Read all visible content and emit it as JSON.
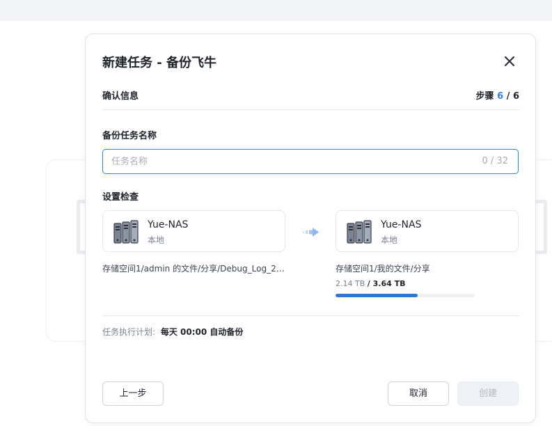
{
  "dialog": {
    "title": "新建任务 - 备份飞牛",
    "section_label": "确认信息",
    "step": {
      "prefix": "步骤",
      "current": "6",
      "separator": "/",
      "total": "6"
    }
  },
  "task_name": {
    "label": "备份任务名称",
    "placeholder": "任务名称",
    "value": "",
    "char_count": "0 / 32"
  },
  "settings": {
    "label": "设置检查",
    "source": {
      "name": "Yue-NAS",
      "location": "本地",
      "path": "存储空间1/admin 的文件/分享/Debug_Log_202..."
    },
    "target": {
      "name": "Yue-NAS",
      "location": "本地",
      "path": "存储空间1/我的文件/分享",
      "used": "2.14 TB",
      "total": "/ 3.64 TB",
      "usage_fraction": 0.588
    },
    "icons": {
      "device": "nas-server-icon",
      "arrow": "transfer-arrow-icon"
    }
  },
  "schedule": {
    "label": "任务执行计划:",
    "value": "每天 00:00 自动备份"
  },
  "buttons": {
    "prev": "上一步",
    "cancel": "取消",
    "create": "创建"
  },
  "colors": {
    "accent": "#2f80ed",
    "progress": "#2f76db",
    "disabled_bg": "#eef1f5",
    "disabled_text": "#b3bac4"
  }
}
